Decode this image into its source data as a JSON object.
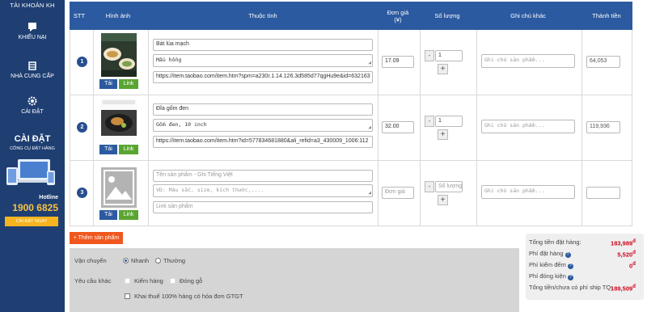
{
  "sidebar": {
    "account": "TÀI KHOẢN KH",
    "items": [
      {
        "label": "KHIẾU NẠI",
        "icon": "complaint-icon"
      },
      {
        "label": "NHÀ CUNG CẤP",
        "icon": "supplier-icon"
      },
      {
        "label": "CÀI ĐẶT",
        "icon": "gear-icon"
      }
    ],
    "promo_title": "CÀI ĐẶT",
    "promo_subtitle": "CÔNG CỤ ĐẶT HÀNG",
    "hotline_label": "Hotline",
    "hotline": "1900 6825",
    "install_button": "CÀI ĐẶT NGAY"
  },
  "table": {
    "headers": [
      "STT",
      "Hình ảnh",
      "Thuộc tính",
      "Đơn giá\n(¥)",
      "Số lượng",
      "Ghi chú khác",
      "Thành tiền"
    ],
    "buttons": {
      "download": "Tải",
      "link": "Link"
    },
    "rows": [
      {
        "index": "1",
        "name": "Bát lúa mạch",
        "properties": "Mầu hồng",
        "url": "https://item.taobao.com/item.htm?spm=a230r.1.14.126.3d585d77qgHu9e&id=632163",
        "price": "17.09",
        "quantity": "1",
        "note_placeholder": "Ghi chú sản phẩm...",
        "total": "64,053"
      },
      {
        "index": "2",
        "name": "Đĩa gốm đen",
        "properties": "Gốm đen, 10 inch",
        "url": "https://item.taobao.com/item.htm?id=577834681880&ali_refid=a3_430009_1006:112",
        "price": "32.00",
        "quantity": "1",
        "note_placeholder": "Ghi chú sản phẩm...",
        "total": "119,936"
      },
      {
        "index": "3",
        "name_placeholder": "Tên sản phẩm - Ghi Tiếng Việt",
        "properties_placeholder": "VD: Màu sắc, size, kích thước,....",
        "url_placeholder": "Link sản phẩm",
        "price_placeholder": "Đơn giá",
        "quantity_placeholder": "Số lượng",
        "note_placeholder": "Ghi chú sản phẩm...",
        "total": ""
      }
    ]
  },
  "add_product": "+ Thêm sản phẩm",
  "options": {
    "shipping_label": "Vận chuyển",
    "shipping_fast": "Nhanh",
    "shipping_normal": "Thường",
    "extra_label": "Yêu cầu khác",
    "inspect": "Kiểm hàng",
    "wood": "Đóng gỗ",
    "tax": "Khai thuế 100% hàng có hóa đơn GTGT"
  },
  "summary": {
    "rows": [
      {
        "label": "Tổng tiền đặt hàng:",
        "value": "183,989",
        "help": false
      },
      {
        "label": "Phí đặt hàng",
        "value": "5,520",
        "help": true
      },
      {
        "label": "Phí kiểm đếm",
        "value": "0",
        "help": true
      },
      {
        "label": "Phí đóng kiện",
        "value": "",
        "help": true
      },
      {
        "label": "Tổng tiền/chưa có phí ship TQ:",
        "value": "189,509",
        "help": false
      }
    ],
    "currency_symbol": "đ"
  },
  "colors": {
    "sidebar": "#1f3f73",
    "header": "#2c5aa0",
    "price_red": "#d0021b",
    "add_button": "#f0571e",
    "link_button": "#5aa532"
  }
}
